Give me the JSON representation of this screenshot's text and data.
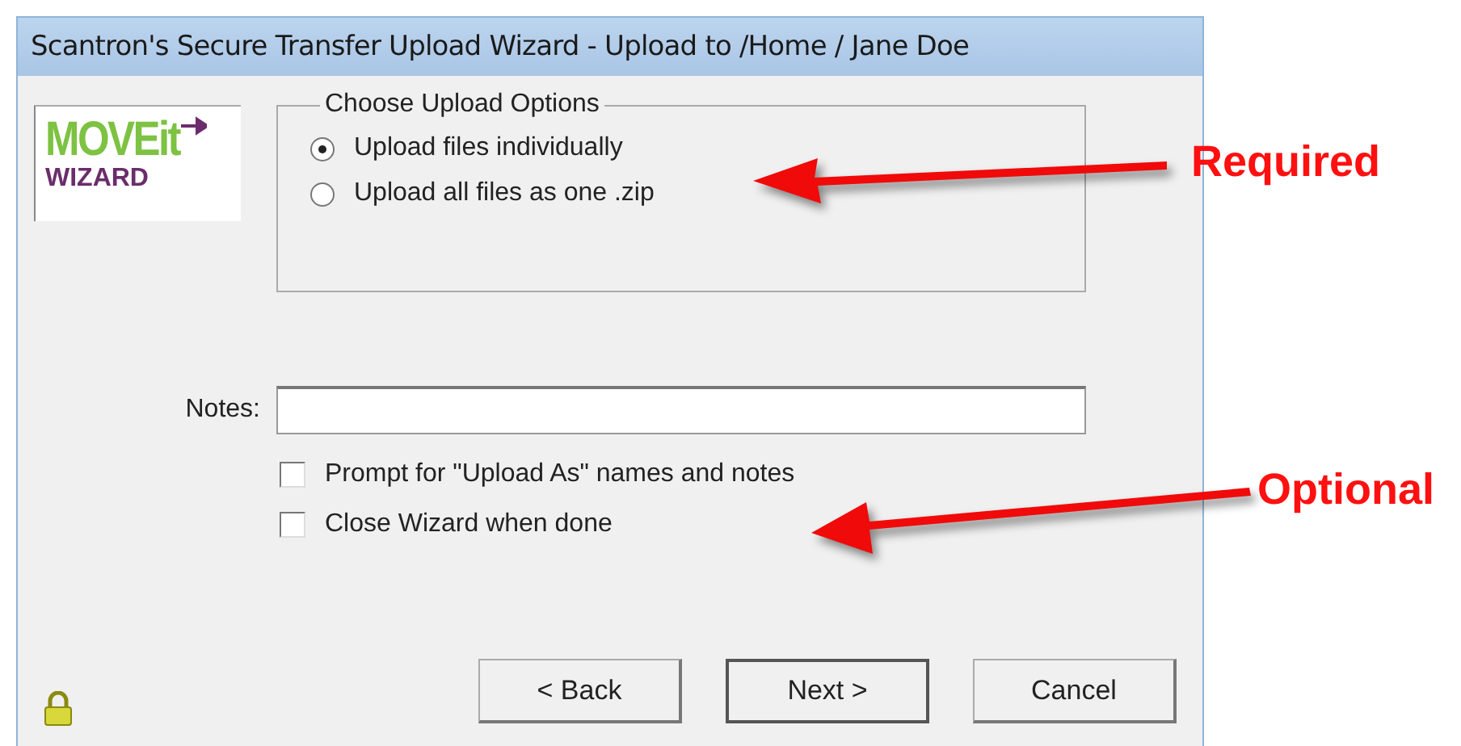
{
  "window": {
    "title": "Scantron's Secure Transfer Upload Wizard - Upload to /Home / Jane Doe"
  },
  "logo": {
    "word": "MOVEit",
    "subtitle": "WIZARD"
  },
  "upload_options": {
    "legend": "Choose Upload Options",
    "options": [
      {
        "label": "Upload files individually",
        "selected": true
      },
      {
        "label": "Upload all files as one .zip",
        "selected": false
      }
    ]
  },
  "notes": {
    "label": "Notes:"
  },
  "checkboxes": [
    {
      "label": "Prompt for \"Upload As\" names and notes",
      "checked": false
    },
    {
      "label": "Close Wizard when done",
      "checked": false
    }
  ],
  "buttons": [
    {
      "label": "< Back",
      "default": false
    },
    {
      "label": "Next >",
      "default": true
    },
    {
      "label": "Cancel",
      "default": false
    }
  ],
  "annotations": [
    {
      "label": "Required"
    },
    {
      "label": "Optional"
    }
  ]
}
